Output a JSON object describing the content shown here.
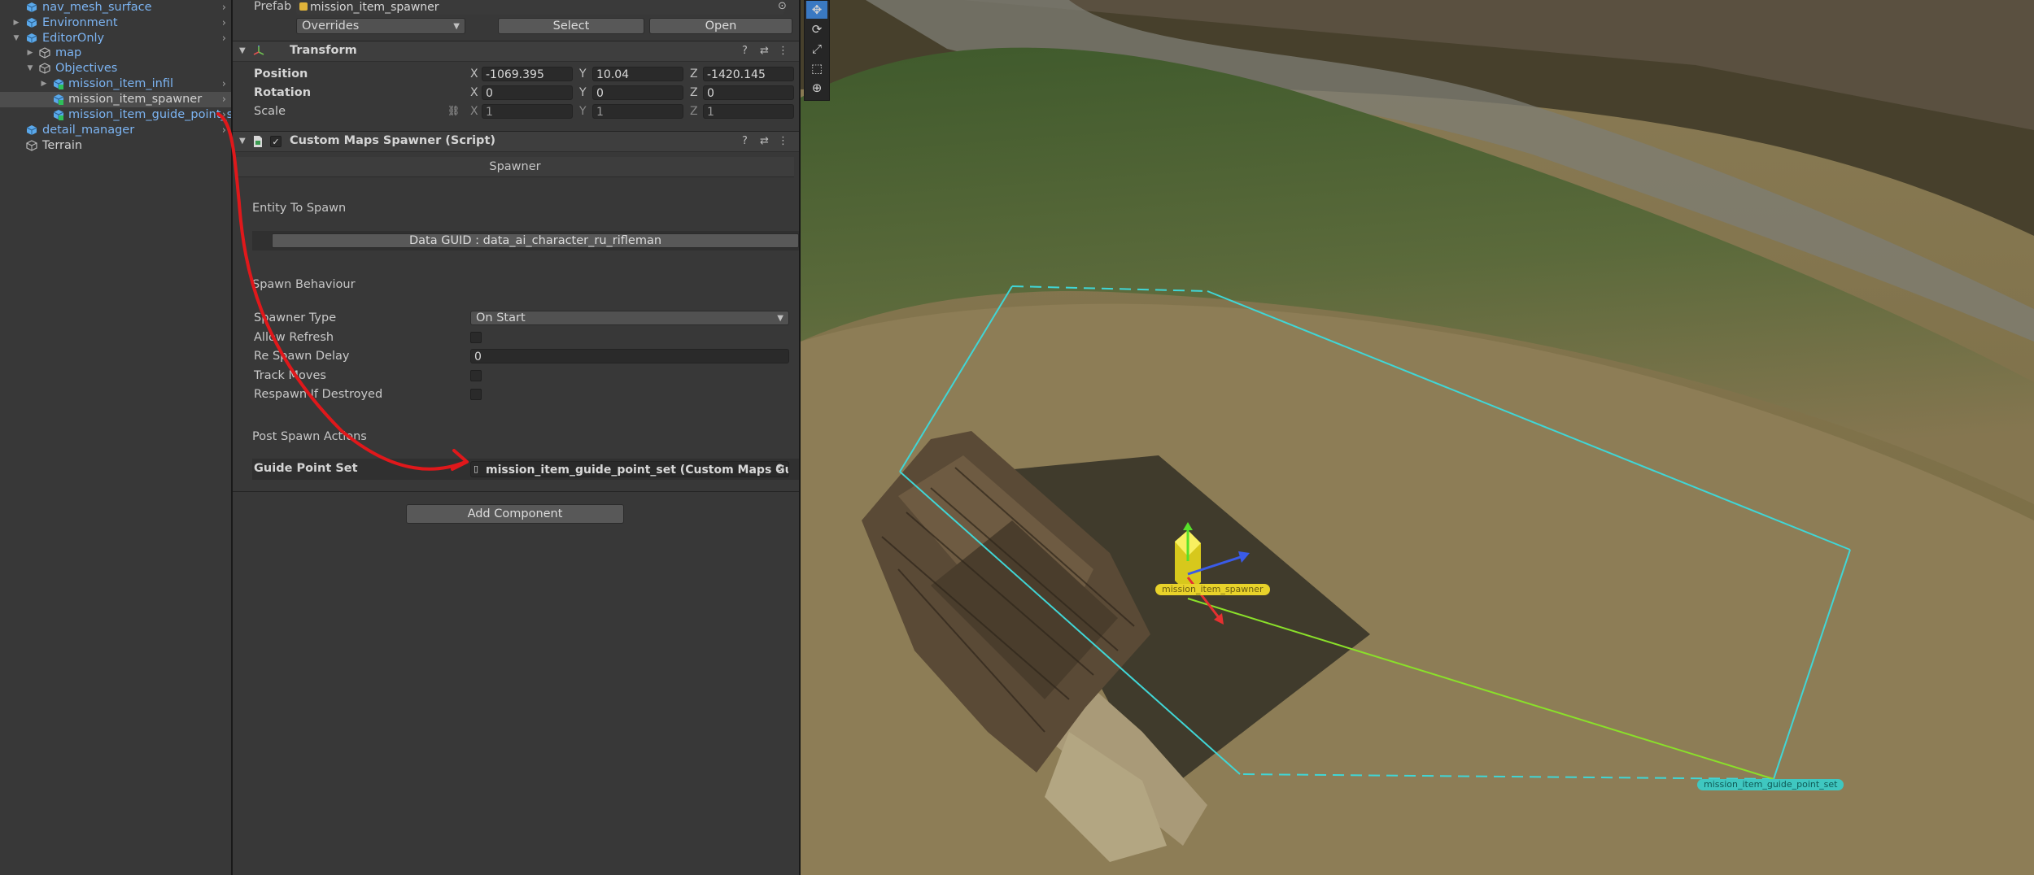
{
  "hierarchy": {
    "items": [
      {
        "label": "nav_mesh_surface",
        "color": "blue"
      },
      {
        "label": "Environment",
        "color": "blue"
      },
      {
        "label": "EditorOnly",
        "color": "blue"
      },
      {
        "label": "map",
        "color": "blue"
      },
      {
        "label": "Objectives",
        "color": "blue"
      },
      {
        "label": "mission_item_infil",
        "color": "blue"
      },
      {
        "label": "mission_item_spawner",
        "color": "white"
      },
      {
        "label": "mission_item_guide_point_s",
        "color": "blue"
      },
      {
        "label": "detail_manager",
        "color": "blue"
      },
      {
        "label": "Terrain",
        "color": "white"
      }
    ]
  },
  "inspector": {
    "prefab_label": "Prefab",
    "prefab_name": "mission_item_spawner",
    "overrides": "Overrides",
    "select_button": "Select",
    "open_button": "Open",
    "transform": {
      "title": "Transform",
      "position_label": "Position",
      "rotation_label": "Rotation",
      "scale_label": "Scale",
      "axis_x": "X",
      "axis_y": "Y",
      "axis_z": "Z",
      "position": {
        "x": "-1069.395",
        "y": "10.04",
        "z": "-1420.145"
      },
      "rotation": {
        "x": "0",
        "y": "0",
        "z": "0"
      },
      "scale": {
        "x": "1",
        "y": "1",
        "z": "1"
      }
    },
    "script": {
      "title": "Custom Maps Spawner (Script)",
      "enabled_check": "✓",
      "banner": "Spawner",
      "entity_section": "Entity To Spawn",
      "data_guid": "Data GUID : data_ai_character_ru_rifleman",
      "behaviour_section": "Spawn Behaviour",
      "spawner_type_label": "Spawner Type",
      "spawner_type_value": "On Start",
      "allow_refresh_label": "Allow Refresh",
      "respawn_delay_label": "Re Spawn Delay",
      "respawn_delay_value": "0",
      "track_moves_label": "Track Moves",
      "respawn_destroyed_label": "Respawn If Destroyed",
      "post_section": "Post Spawn Actions",
      "guide_point_label": "Guide Point Set",
      "guide_point_value": "mission_item_guide_point_set (Custom Maps Guide"
    },
    "add_component": "Add Component"
  },
  "scene": {
    "spawner_tag": "mission_item_spawner",
    "guide_tag": "mission_item_guide_point_set",
    "tools": [
      "move-tool",
      "rotate-tool",
      "scale-tool",
      "rect-tool",
      "transform-tool"
    ]
  },
  "colors": {
    "hierarchy_blue": "#7cb4f2",
    "selection_line": "#40d6d6",
    "annotation_arrow": "#e0181b",
    "active_tool": "#3a79c2"
  }
}
